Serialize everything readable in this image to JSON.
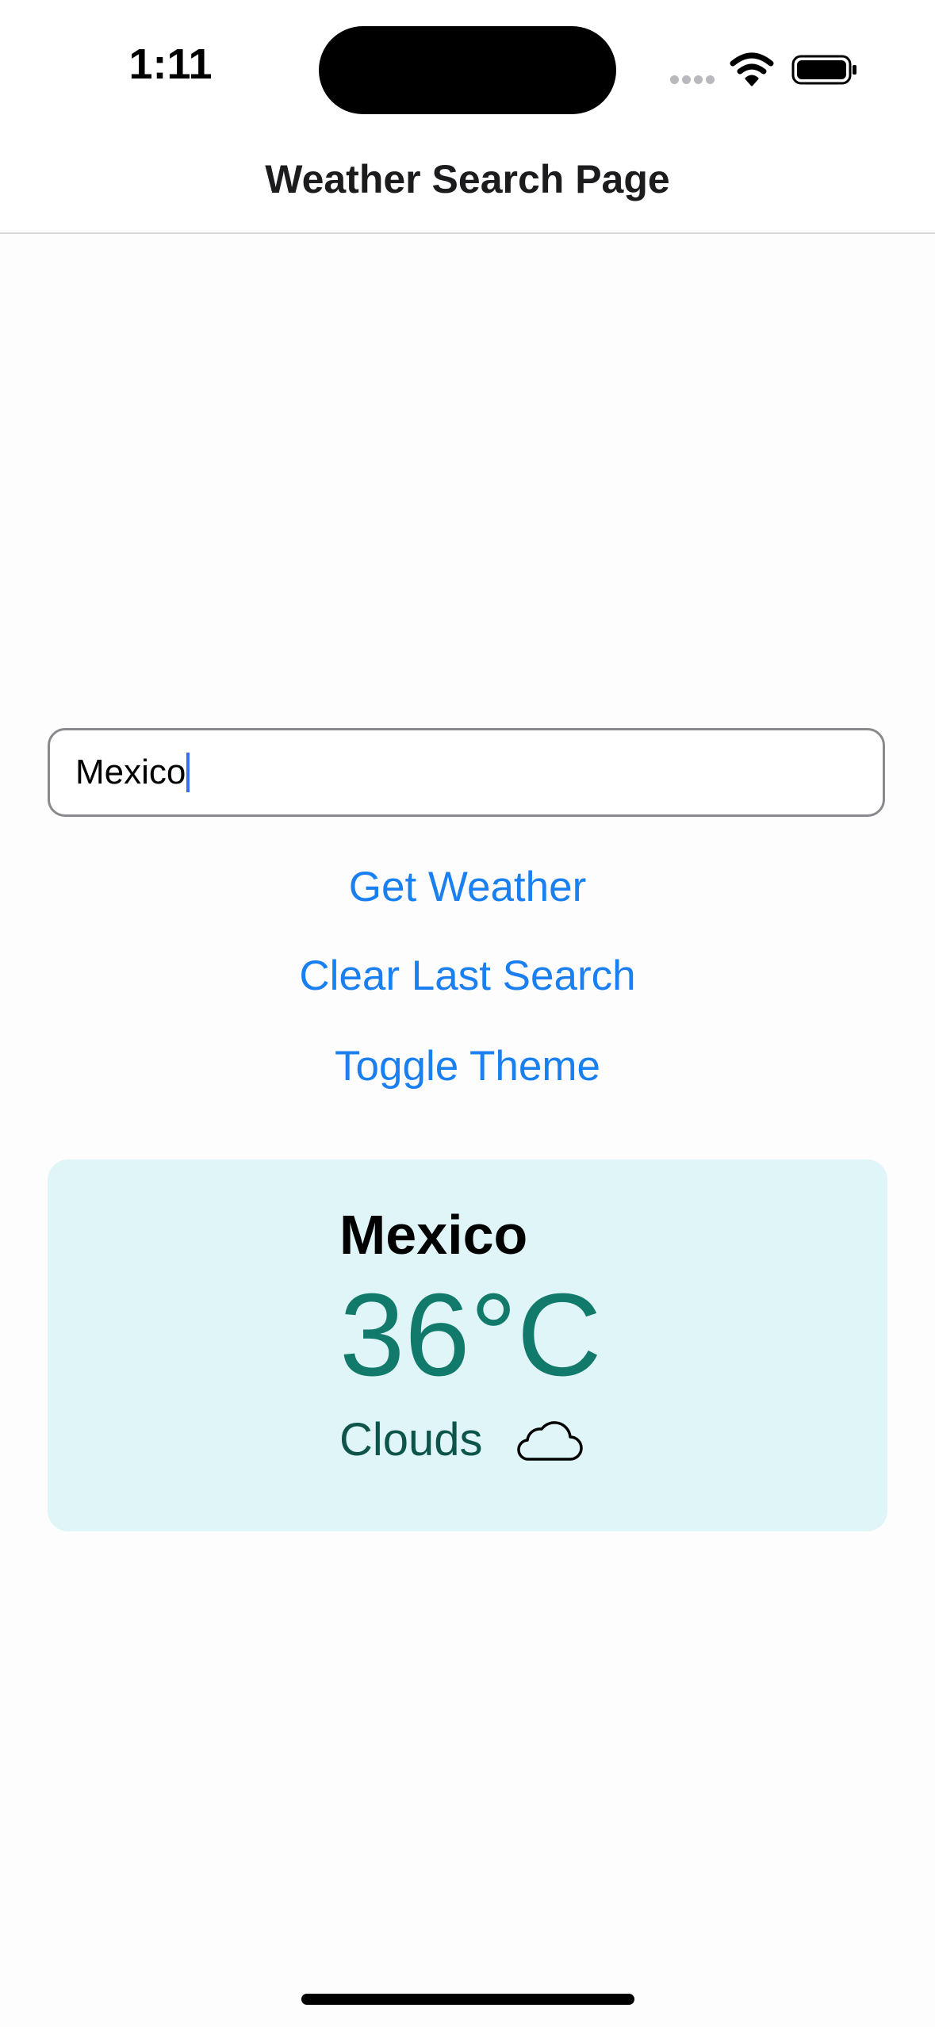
{
  "status_bar": {
    "time": "1:11"
  },
  "header": {
    "title": "Weather Search Page"
  },
  "search": {
    "value": "Mexico"
  },
  "buttons": {
    "get_weather": "Get Weather",
    "clear_last_search": "Clear Last Search",
    "toggle_theme": "Toggle Theme"
  },
  "weather": {
    "city": "Mexico",
    "temperature": "36°C",
    "condition": "Clouds",
    "icon": "cloud-icon"
  },
  "colors": {
    "accent": "#1a7ff0",
    "card_background": "#dff5f7",
    "temperature": "#127a6b",
    "condition": "#0d544a"
  }
}
